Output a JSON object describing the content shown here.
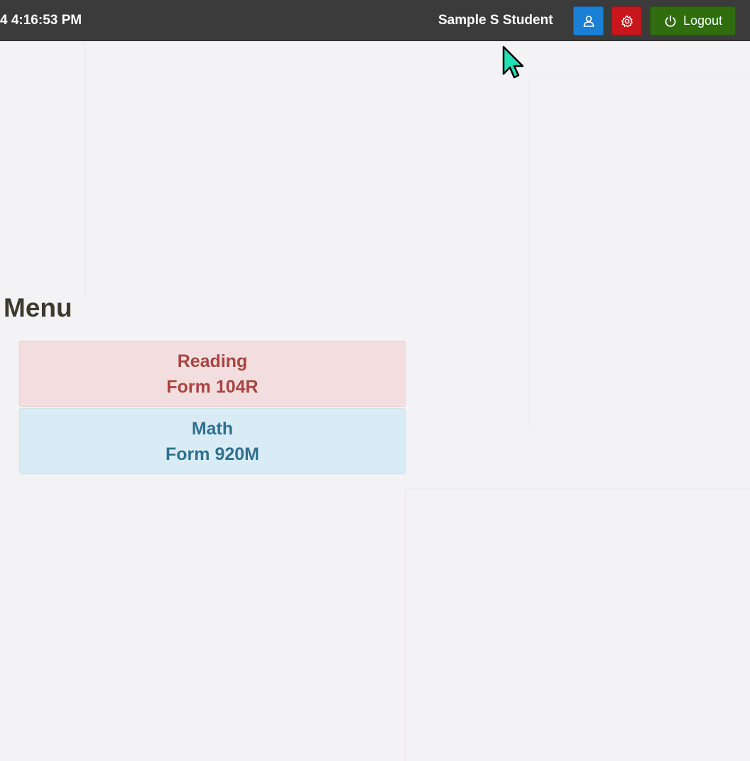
{
  "header": {
    "clock": "4 4:16:53 PM",
    "user_name": "Sample S Student",
    "profile_icon": "user-icon",
    "settings_icon": "gear-icon",
    "logout_icon": "power-icon",
    "logout_label": "Logout",
    "colors": {
      "bar": "#3b3b3b",
      "profile": "#1a7fd6",
      "settings": "#c8161d",
      "logout": "#2f6d0f"
    }
  },
  "menu": {
    "title": "Menu",
    "items": [
      {
        "subject": "Reading",
        "form": "Form 104R",
        "bg": "#f2dede",
        "fg": "#a94442"
      },
      {
        "subject": "Math",
        "form": "Form 920M",
        "bg": "#d9ecf5",
        "fg": "#31708f"
      }
    ]
  }
}
